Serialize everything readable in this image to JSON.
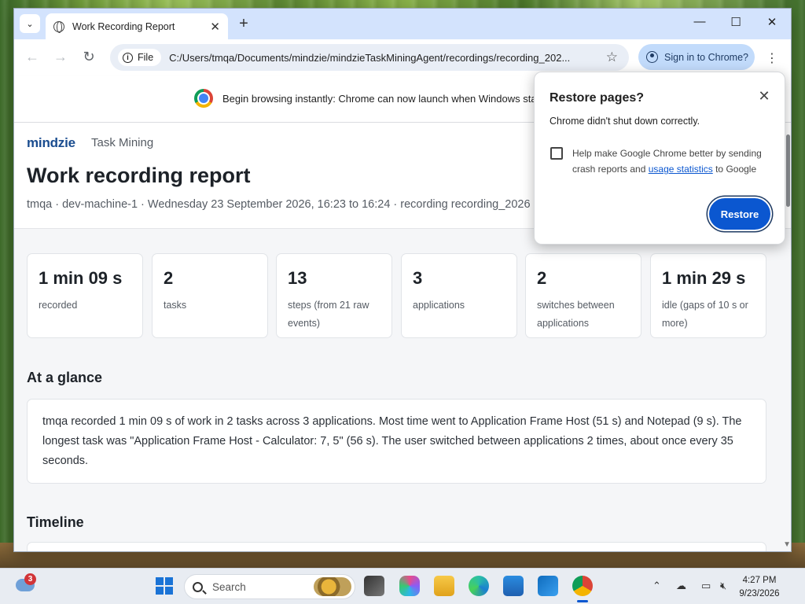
{
  "browser": {
    "tab_title": "Work Recording Report",
    "new_tab_label": "+",
    "window_controls": {
      "minimize": "—",
      "maximize": "☐",
      "close": "✕"
    },
    "nav": {
      "back": "←",
      "forward": "→",
      "reload": "↻"
    },
    "address": {
      "chip_label": "File",
      "url": "C:/Users/tmqa/Documents/mindzie/mindzieTaskMiningAgent/recordings/recording_202..."
    },
    "sign_in_label": "Sign in to Chrome?",
    "infobar_text": "Begin browsing instantly: Chrome can now launch when Windows sta"
  },
  "report": {
    "brand": "mindzie",
    "brand_sub": "Task Mining",
    "title": "Work recording report",
    "meta": "tmqa · dev-machine-1 · Wednesday 23 September 2026, 16:23 to 16:24 · recording recording_2026",
    "stats": [
      {
        "value": "1 min 09 s",
        "label": "recorded"
      },
      {
        "value": "2",
        "label": "tasks"
      },
      {
        "value": "13",
        "label": "steps (from 21 raw events)"
      },
      {
        "value": "3",
        "label": "applications"
      },
      {
        "value": "2",
        "label": "switches between applications"
      },
      {
        "value": "1 min 29 s",
        "label": "idle (gaps of 10 s or more)"
      }
    ],
    "glance_heading": "At a glance",
    "glance_text": "tmqa recorded 1 min 09 s of work in 2 tasks across 3 applications. Most time went to Application Frame Host (51 s) and Notepad (9 s). The longest task was \"Application Frame Host - Calculator: 7, 5\" (56 s). The user switched between applications 2 times, about once every 35 seconds.",
    "timeline_heading": "Timeline"
  },
  "popup": {
    "title": "Restore pages?",
    "message": "Chrome didn't shut down correctly.",
    "checkbox_text_before": "Help make Google Chrome better by sending crash reports and ",
    "checkbox_link": "usage statistics",
    "checkbox_text_after": " to Google",
    "restore_label": "Restore",
    "close_label": "✕"
  },
  "taskbar": {
    "weather_badge": "3",
    "search_placeholder": "Search",
    "clock_time": "4:27 PM",
    "clock_date": "9/23/2026",
    "apps": [
      "file-explorer-icon",
      "m365-icon",
      "folder-icon",
      "edge-icon",
      "store-icon",
      "outlook-icon",
      "chrome-icon"
    ]
  }
}
